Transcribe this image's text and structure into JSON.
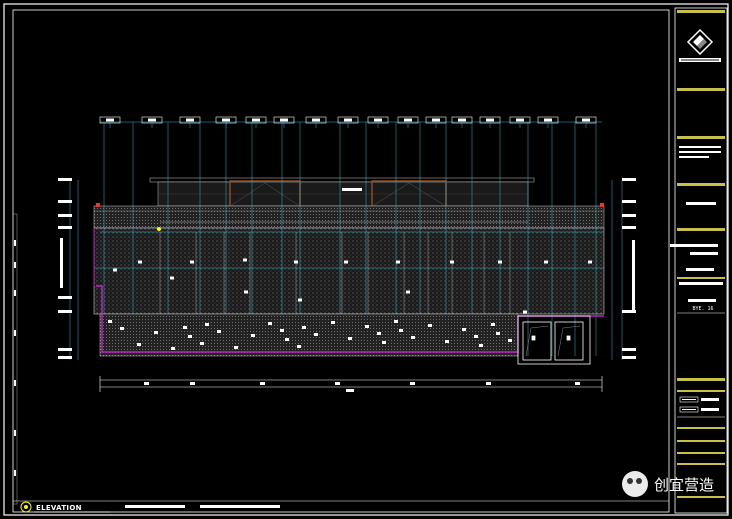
{
  "drawing": {
    "view_label": "ELEVATION",
    "revision_code": "BYE. 16",
    "watermark_text": "创宜营造",
    "colors": {
      "background": "#000000",
      "frame": "#ffffff",
      "titleblock_bar": "#c8c04a",
      "dimension_line": "#29b6d6",
      "magenta_outline": "#c21fc9",
      "wood_frame": "#8a4b1f",
      "hatch": "#6b6b6b"
    }
  },
  "icons": {
    "logo": "company-logo-icon",
    "wechat": "wechat-icon"
  }
}
